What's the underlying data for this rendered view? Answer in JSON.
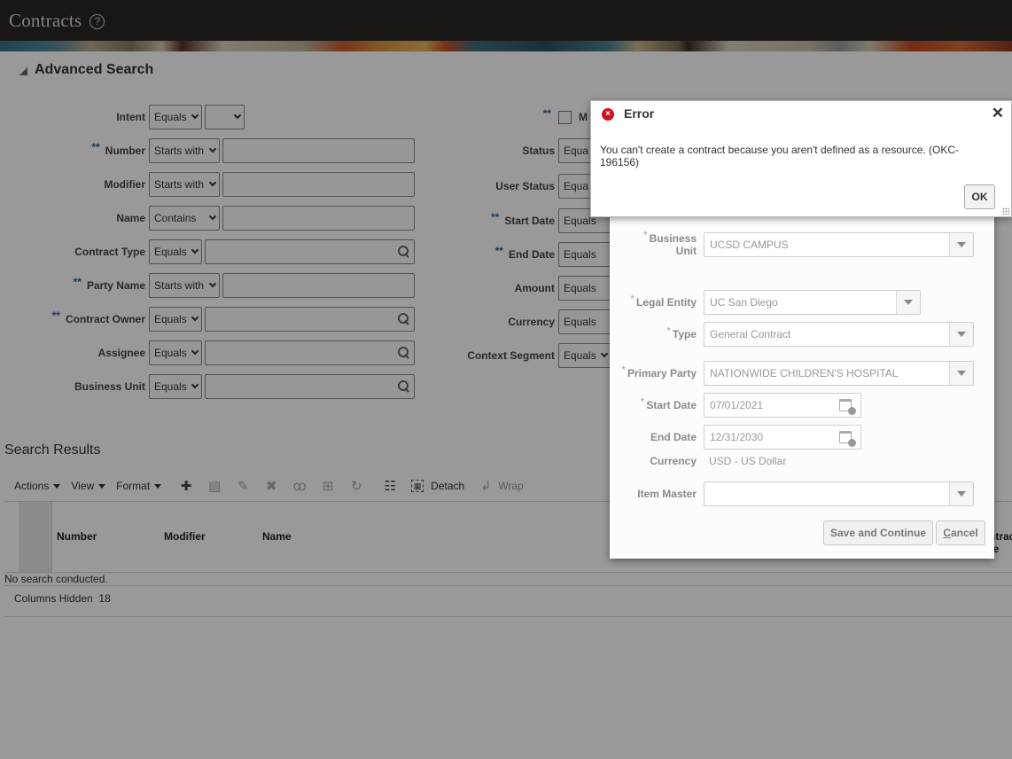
{
  "header": {
    "title": "Contracts",
    "help_icon": "help-circle-icon"
  },
  "advanced_search": {
    "title": "Advanced Search",
    "left_fields": [
      {
        "label": "Intent",
        "operator": "Equals",
        "value": "",
        "required_marker": "",
        "input_type": "select"
      },
      {
        "label": "Number",
        "operator": "Starts with",
        "value": "",
        "required_marker": "**",
        "input_type": "text"
      },
      {
        "label": "Modifier",
        "operator": "Starts with",
        "value": "",
        "required_marker": "",
        "input_type": "text"
      },
      {
        "label": "Name",
        "operator": "Contains",
        "value": "",
        "required_marker": "",
        "input_type": "text"
      },
      {
        "label": "Contract Type",
        "operator": "Equals",
        "value": "",
        "required_marker": "",
        "input_type": "lov"
      },
      {
        "label": "Party Name",
        "operator": "Starts with",
        "value": "",
        "required_marker": "**",
        "input_type": "text"
      },
      {
        "label": "Contract Owner",
        "operator": "Equals",
        "value": "",
        "required_marker": "**",
        "input_type": "lov"
      },
      {
        "label": "Assignee",
        "operator": "Equals",
        "value": "",
        "required_marker": "",
        "input_type": "lov"
      },
      {
        "label": "Business Unit",
        "operator": "Equals",
        "value": "",
        "required_marker": "",
        "input_type": "lov"
      }
    ],
    "right_fields": [
      {
        "label": "M",
        "required_marker": "**",
        "input_type": "checkbox",
        "checked": false
      },
      {
        "label": "Status",
        "operator": "Equa",
        "required_marker": ""
      },
      {
        "label": "User Status",
        "operator": "Equa",
        "required_marker": ""
      },
      {
        "label": "Start Date",
        "operator": "Equals",
        "required_marker": "**"
      },
      {
        "label": "End Date",
        "operator": "Equals",
        "required_marker": "**"
      },
      {
        "label": "Amount",
        "operator": "Equals",
        "required_marker": ""
      },
      {
        "label": "Currency",
        "operator": "Equals",
        "required_marker": ""
      },
      {
        "label": "Context Segment",
        "operator": "Equals",
        "required_marker": ""
      }
    ]
  },
  "search_results": {
    "title": "Search Results",
    "menus": [
      "Actions",
      "View",
      "Format"
    ],
    "toolbar_icons": [
      {
        "name": "add-icon",
        "glyph": "✚",
        "enabled": true
      },
      {
        "name": "duplicate-icon",
        "glyph": "▤",
        "enabled": false
      },
      {
        "name": "edit-icon",
        "glyph": "✎",
        "enabled": false
      },
      {
        "name": "delete-icon",
        "glyph": "✖",
        "enabled": false
      },
      {
        "name": "view-icon",
        "glyph": "ꝏ",
        "enabled": false
      },
      {
        "name": "freeze-icon",
        "glyph": "⊞",
        "enabled": false
      },
      {
        "name": "refresh-icon",
        "glyph": "↻",
        "enabled": false
      },
      {
        "name": "query-by-example-icon",
        "glyph": "☷",
        "enabled": true
      }
    ],
    "detach_label": "Detach",
    "wrap_label": "Wrap",
    "columns": [
      "Number",
      "Modifier",
      "Name",
      "Contract Type"
    ],
    "empty_message": "No search conducted.",
    "columns_hidden_label": "Columns Hidden",
    "columns_hidden_count": "18"
  },
  "create_dialog": {
    "fields": {
      "business_unit": {
        "label_line1": "Business",
        "label_line2": "Unit",
        "value": "UCSD CAMPUS",
        "required": "*"
      },
      "legal_entity": {
        "label": "Legal Entity",
        "value": "UC San Diego",
        "required": "*"
      },
      "type": {
        "label": "Type",
        "value": "General Contract",
        "required": "*"
      },
      "primary_party": {
        "label": "Primary Party",
        "value": "NATIONWIDE CHILDREN'S HOSPITAL",
        "required": "*"
      },
      "start_date": {
        "label": "Start Date",
        "value": "07/01/2021",
        "required": "*"
      },
      "end_date": {
        "label": "End Date",
        "value": "12/31/2030"
      },
      "currency": {
        "label": "Currency",
        "value": "USD - US Dollar"
      },
      "item_master": {
        "label": "Item Master",
        "value": ""
      }
    },
    "save_button": "Save and Continue",
    "cancel_button_first": "C",
    "cancel_button_rest": "ancel"
  },
  "error_dialog": {
    "title": "Error",
    "message": "You can't create a contract because you aren't defined as a resource. (OKC-196156)",
    "ok_button": "OK",
    "error_color": "#d0121f"
  }
}
